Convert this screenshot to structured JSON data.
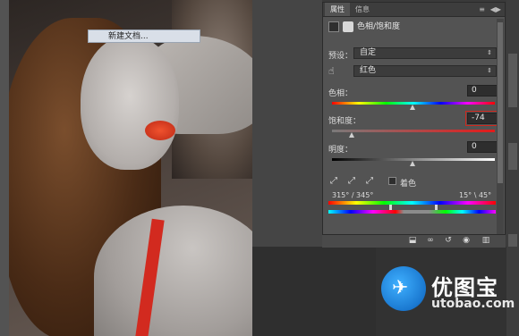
{
  "canvas": {
    "context_menu": {
      "item": "新建文档..."
    }
  },
  "panel": {
    "tabs": [
      {
        "label": "属性"
      },
      {
        "label": "信息"
      }
    ],
    "tab_controls": "◀▶",
    "menu_icon": "≡",
    "title": "色相/饱和度",
    "preset": {
      "label": "预设：",
      "value": "自定"
    },
    "channel": {
      "value": "红色"
    },
    "hue": {
      "label": "色相：",
      "value": "0"
    },
    "saturation": {
      "label": "饱和度：",
      "value": "-74"
    },
    "lightness": {
      "label": "明度：",
      "value": "0"
    },
    "colorize": {
      "label": "着色"
    },
    "range_left": "315° / 345°",
    "range_right": "15° \\ 45°"
  },
  "logo": {
    "title": "优图宝",
    "url": "utobao.com"
  },
  "icons": {
    "hand": "hand-icon",
    "eyedropper": "eyedropper-icon",
    "eye": "eye-icon",
    "trash": "trash-icon",
    "reset": "reset-icon",
    "mask": "layer-mask-icon",
    "link": "link-icon"
  },
  "colors": {
    "highlight_box": "#d0261c",
    "lips": "#e0401f",
    "strap": "#d22a1f",
    "logo_blue": "#1a78d0"
  }
}
